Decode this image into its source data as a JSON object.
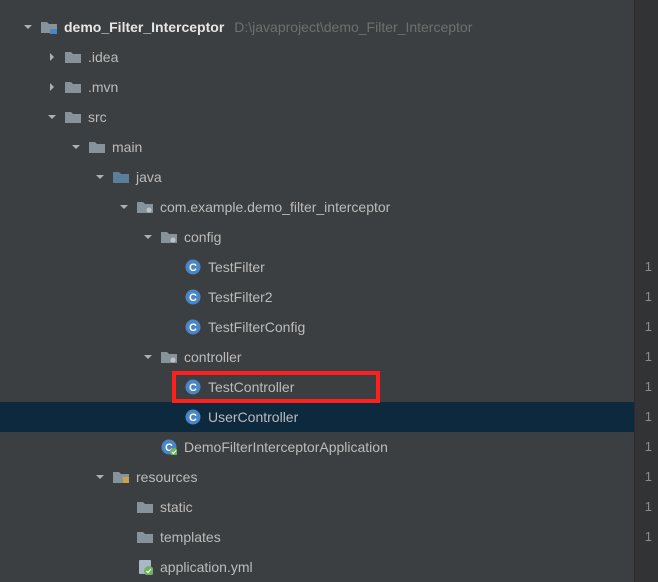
{
  "root": {
    "name": "demo_Filter_Interceptor",
    "path": "D:\\javaproject\\demo_Filter_Interceptor"
  },
  "nodes": {
    "idea": ".idea",
    "mvn": ".mvn",
    "src": "src",
    "main": "main",
    "java": "java",
    "pkg": "com.example.demo_filter_interceptor",
    "config": "config",
    "testFilter": "TestFilter",
    "testFilter2": "TestFilter2",
    "testFilterConfig": "TestFilterConfig",
    "controller": "controller",
    "testController": "TestController",
    "userController": "UserController",
    "app": "DemoFilterInterceptorApplication",
    "resources": "resources",
    "static": "static",
    "templates": "templates",
    "appyml": "application.yml"
  },
  "gutter": [
    "1",
    "1",
    "1",
    "1",
    "1",
    "1",
    "1",
    "1",
    "1",
    "1"
  ],
  "colors": {
    "classCircle": "#4a86c7",
    "folder": "#87939a",
    "sourceFolder": "#5b7e9a",
    "springGreen": "#6fb35f",
    "yml": "#c97f3b"
  }
}
